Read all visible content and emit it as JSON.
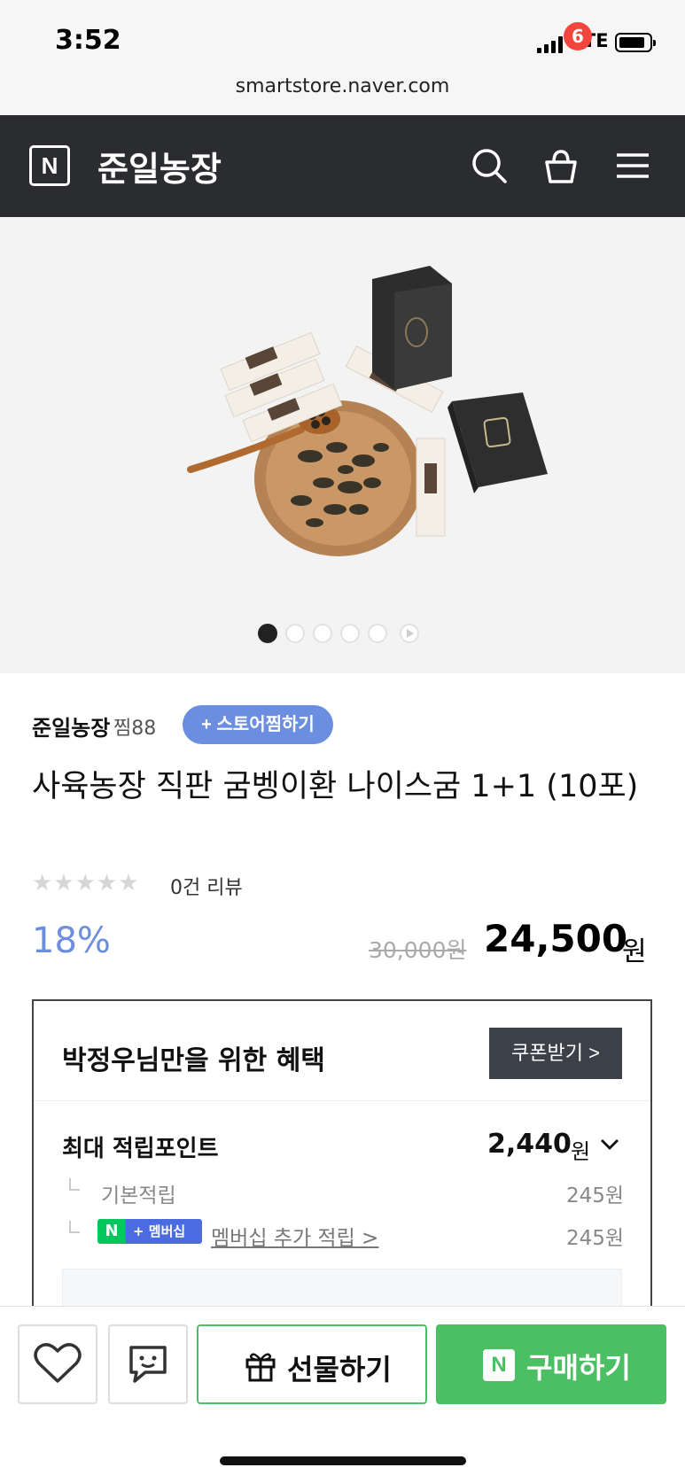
{
  "status_bar": {
    "time": "3:52",
    "network": "LTE"
  },
  "browser": {
    "url": "smartstore.naver.com"
  },
  "header": {
    "logo": "N",
    "store_name": "준일농장",
    "cart_count": "6",
    "icons": [
      "search-icon",
      "cart-icon",
      "menu-icon"
    ]
  },
  "product": {
    "store_name": "준일농장",
    "wish_count": "찜88",
    "follow_label": "+ 스토어찜하기",
    "title": "사육농장 직판 굼벵이환 나이스굼 1+1 (10포)",
    "stars": "★★★★★",
    "rating": 0,
    "review_count": "0건 리뷰",
    "discount": "18%",
    "original_price": "30,000원",
    "sale_price": "24,500",
    "currency": "원",
    "image_slide": {
      "current": 1,
      "total": 6
    }
  },
  "benefit": {
    "title": "박정우님만을 위한 혜택",
    "coupon_label": "쿠폰받기 >",
    "points_label": "최대 적립포인트",
    "points_value": "2,440",
    "points_unit": "원",
    "basic_label": "기본적립",
    "basic_value": "245원",
    "membership_badge_n": "N",
    "membership_badge_text": "+ 멤버십",
    "membership_label": "멤버십 추가 적립 >",
    "membership_value": "245원"
  },
  "bottom_bar": {
    "gift_label": "선물하기",
    "buy_label": "구매하기",
    "buy_logo": "N"
  },
  "colors": {
    "header_bg": "#2b2c2f",
    "accent_blue": "#6b8ee0",
    "badge_red": "#f1453d",
    "buy_green": "#4cbf64",
    "naver_green": "#03c75a"
  }
}
